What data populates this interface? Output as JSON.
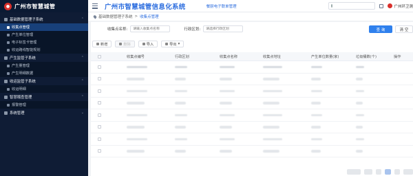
{
  "brand": {
    "title": "广州市智慧城管"
  },
  "header": {
    "title": "广州市智慧城管信息化系统",
    "subsystem": "餐厨电子联单管理",
    "user": "广州环卫测",
    "search_placeholder": ""
  },
  "sidebar": {
    "groups": [
      {
        "label": "基础数据管理子系统",
        "expanded": true,
        "items": [
          {
            "label": "收集点管理",
            "active": true
          },
          {
            "label": "产生单位管理",
            "active": false
          },
          {
            "label": "电子标签卡管理",
            "active": false
          },
          {
            "label": "收运路线智能规划",
            "active": false
          }
        ]
      },
      {
        "label": "产生监管子系统",
        "expanded": true,
        "items": [
          {
            "label": "产生量管理",
            "active": false
          },
          {
            "label": "产生明细数据",
            "active": false
          }
        ]
      },
      {
        "label": "收运监管子系统",
        "expanded": true,
        "items": [
          {
            "label": "收运明细",
            "active": false
          }
        ]
      },
      {
        "label": "智慧稽查管理",
        "expanded": true,
        "items": [
          {
            "label": "报警管理",
            "active": false
          }
        ]
      },
      {
        "label": "系统管理",
        "expanded": false,
        "items": []
      }
    ]
  },
  "breadcrumb": {
    "parent": "基础数据管理子系统",
    "separator": ">",
    "current": "收集点管理"
  },
  "filters": {
    "name_label": "收集点名称:",
    "name_placeholder": "请输入收集点名称",
    "district_label": "行政区划:",
    "district_placeholder": "请选择行政区划",
    "search_button": "查 询",
    "clear_button": "清 空"
  },
  "toolbar": {
    "add": "新增",
    "delete": "删除",
    "import": "导入",
    "export": "导出"
  },
  "table": {
    "headers": [
      "收集点编号",
      "行政区划",
      "收集点名称",
      "收集点地址",
      "产生单位数量(家)",
      "垃圾桶数(个)",
      "操作"
    ],
    "row_count": 8
  },
  "colors": {
    "sidebar_bg": "#0f1c35",
    "active_item": "#18407a",
    "primary": "#2f80ed",
    "title": "#2f6fdf"
  }
}
